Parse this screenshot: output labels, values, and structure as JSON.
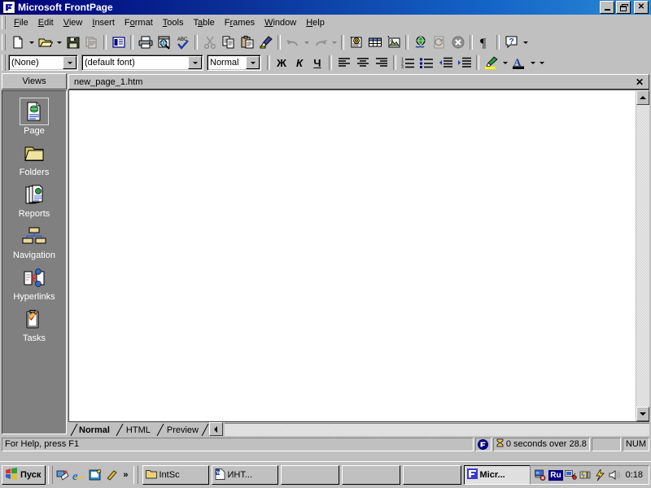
{
  "window": {
    "title": "Microsoft FrontPage",
    "icon": "frontpage-icon",
    "buttons": {
      "minimize": "_",
      "restore": "restore",
      "close": "x"
    }
  },
  "menubar": {
    "items": [
      {
        "label": "File",
        "accel": "F"
      },
      {
        "label": "Edit",
        "accel": "E"
      },
      {
        "label": "View",
        "accel": "V"
      },
      {
        "label": "Insert",
        "accel": "I"
      },
      {
        "label": "Format",
        "accel": "o"
      },
      {
        "label": "Tools",
        "accel": "T"
      },
      {
        "label": "Table",
        "accel": "a"
      },
      {
        "label": "Frames",
        "accel": "r"
      },
      {
        "label": "Window",
        "accel": "W"
      },
      {
        "label": "Help",
        "accel": "H"
      }
    ]
  },
  "standard_toolbar": {
    "buttons": [
      {
        "name": "new-page-button",
        "icon": "new-document-icon",
        "dropdown": true,
        "enabled": true
      },
      {
        "name": "open-button",
        "icon": "open-folder-icon",
        "dropdown": true,
        "enabled": true
      },
      {
        "name": "save-button",
        "icon": "save-disk-icon",
        "dropdown": false,
        "enabled": true
      },
      {
        "name": "publish-web-button",
        "icon": "publish-icon",
        "dropdown": false,
        "enabled": false
      },
      {
        "name": "folder-list-button",
        "icon": "folder-list-icon",
        "dropdown": false,
        "enabled": true
      },
      {
        "name": "print-button",
        "icon": "printer-icon",
        "dropdown": false,
        "enabled": true
      },
      {
        "name": "preview-in-browser-button",
        "icon": "preview-browser-icon",
        "dropdown": false,
        "enabled": true
      },
      {
        "name": "spelling-button",
        "icon": "spelling-abc-icon",
        "dropdown": false,
        "enabled": true
      },
      {
        "name": "cut-button",
        "icon": "scissors-icon",
        "dropdown": false,
        "enabled": false
      },
      {
        "name": "copy-button",
        "icon": "copy-icon",
        "dropdown": false,
        "enabled": true
      },
      {
        "name": "paste-button",
        "icon": "paste-icon",
        "dropdown": false,
        "enabled": true
      },
      {
        "name": "format-painter-button",
        "icon": "paintbrush-icon",
        "dropdown": false,
        "enabled": true
      },
      {
        "name": "undo-button",
        "icon": "undo-arrow-icon",
        "dropdown": true,
        "enabled": false
      },
      {
        "name": "redo-button",
        "icon": "redo-arrow-icon",
        "dropdown": true,
        "enabled": false
      },
      {
        "name": "insert-component-button",
        "icon": "component-icon",
        "dropdown": false,
        "enabled": true
      },
      {
        "name": "insert-table-button",
        "icon": "table-grid-icon",
        "dropdown": false,
        "enabled": true
      },
      {
        "name": "insert-picture-button",
        "icon": "picture-icon",
        "dropdown": false,
        "enabled": true
      },
      {
        "name": "insert-hyperlink-button",
        "icon": "globe-link-icon",
        "dropdown": false,
        "enabled": true
      },
      {
        "name": "refresh-button",
        "icon": "refresh-page-icon",
        "dropdown": false,
        "enabled": false
      },
      {
        "name": "stop-button",
        "icon": "stop-icon",
        "dropdown": false,
        "enabled": false
      },
      {
        "name": "show-all-button",
        "icon": "pilcrow-icon",
        "dropdown": false,
        "enabled": true
      },
      {
        "name": "help-button",
        "icon": "question-help-icon",
        "dropdown": true,
        "enabled": true
      }
    ]
  },
  "format_toolbar": {
    "style_combo": {
      "value": "(None)",
      "name": "style-combo"
    },
    "font_combo": {
      "value": "(default font)",
      "name": "font-combo"
    },
    "size_combo": {
      "value": "Normal",
      "name": "font-size-combo"
    },
    "bold": {
      "label": "Ж",
      "name": "bold-button"
    },
    "italic": {
      "label": "К",
      "name": "italic-button"
    },
    "underline": {
      "label": "Ч",
      "name": "underline-button"
    },
    "align_left": {
      "icon": "align-left-icon"
    },
    "align_center": {
      "icon": "align-center-icon"
    },
    "align_right": {
      "icon": "align-right-icon"
    },
    "numbered_list": {
      "icon": "numbered-list-icon"
    },
    "bulleted_list": {
      "icon": "bulleted-list-icon"
    },
    "decrease_indent": {
      "icon": "decrease-indent-icon"
    },
    "increase_indent": {
      "icon": "increase-indent-icon"
    },
    "highlight": {
      "icon": "highlight-pen-icon",
      "color": "#ffff00"
    },
    "font_color": {
      "icon": "font-color-icon",
      "color": "#000000"
    }
  },
  "views_bar": {
    "header": "Views",
    "items": [
      {
        "label": "Page",
        "icon": "page-view-icon",
        "selected": true
      },
      {
        "label": "Folders",
        "icon": "folders-view-icon",
        "selected": false
      },
      {
        "label": "Reports",
        "icon": "reports-view-icon",
        "selected": false
      },
      {
        "label": "Navigation",
        "icon": "navigation-view-icon",
        "selected": false
      },
      {
        "label": "Hyperlinks",
        "icon": "hyperlinks-view-icon",
        "selected": false
      },
      {
        "label": "Tasks",
        "icon": "tasks-view-icon",
        "selected": false
      }
    ]
  },
  "document": {
    "filename": "new_page_1.htm",
    "close_label": "✕",
    "content": ""
  },
  "view_tabs": {
    "tabs": [
      {
        "label": "Normal",
        "active": true
      },
      {
        "label": "HTML",
        "active": false
      },
      {
        "label": "Preview",
        "active": false
      }
    ]
  },
  "status_bar": {
    "message": "For Help, press F1",
    "fp_icon": "frontpage-status-icon",
    "download_time": "0 seconds over 28.8",
    "download_icon": "hourglass-icon",
    "blank_panel": "",
    "num_lock": "NUM"
  },
  "taskbar": {
    "start": {
      "label": "Пуск",
      "icon": "windows-logo-icon"
    },
    "quick_launch": [
      {
        "name": "show-desktop-icon"
      },
      {
        "name": "internet-explorer-icon"
      },
      {
        "name": "outlook-express-icon"
      },
      {
        "name": "media-player-icon"
      }
    ],
    "overflow": "»",
    "buttons": [
      {
        "label": "IntSc",
        "icon": "folder-icon",
        "active": false
      },
      {
        "label": "ИНТ...",
        "icon": "word-document-icon",
        "active": false
      },
      {
        "label": "",
        "icon": "",
        "active": false
      },
      {
        "label": "",
        "icon": "",
        "active": false
      },
      {
        "label": "",
        "icon": "",
        "active": false
      },
      {
        "label": "Micr...",
        "icon": "frontpage-icon",
        "active": true
      }
    ],
    "tray": {
      "icons": [
        "modem-icon",
        "volume-icon",
        "network-icon",
        "power-icon"
      ],
      "language": "Ru",
      "clock": "0:18"
    }
  },
  "colors": {
    "face": "#c0c0c0",
    "title_start": "#00007b",
    "title_end": "#2a8ad4",
    "views_bg": "#808080",
    "accent": "#000080"
  }
}
